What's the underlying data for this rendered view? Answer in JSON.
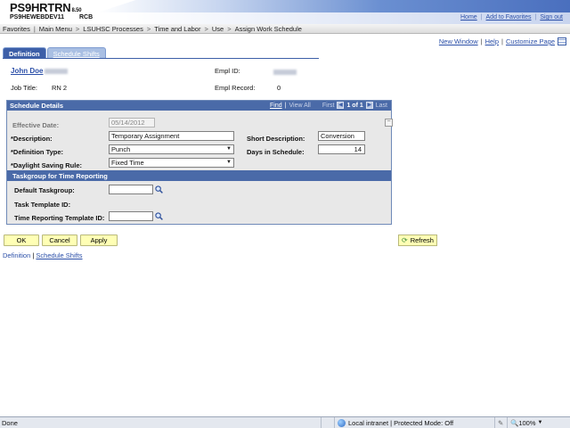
{
  "header": {
    "app_title": "PS9HRTRN",
    "app_version": "8.50",
    "db_name": "PS9HEWEBDEV11",
    "server_code": "RCB",
    "links": [
      "Home",
      "Add to Favorites",
      "Sign out"
    ]
  },
  "breadcrumb": {
    "items": [
      "Favorites",
      "Main Menu",
      "LSUHSC Processes",
      "Time and Labor",
      "Use",
      "Assign Work Schedule"
    ]
  },
  "tabs": [
    {
      "label": "Definition",
      "active": true
    },
    {
      "label": "Schedule Shifts",
      "active": false
    }
  ],
  "page_links": {
    "new_window": "New Window",
    "help": "Help",
    "customize": "Customize Page"
  },
  "employee": {
    "name": "John Doe",
    "empl_id_label": "Empl ID:",
    "job_title_label": "Job Title:",
    "job_title": "RN 2",
    "empl_record_label": "Empl Record:",
    "empl_record": "0"
  },
  "schedule_details": {
    "title": "Schedule Details",
    "nav": {
      "find": "Find",
      "view_all": "View All",
      "first": "First",
      "pager": "1 of 1",
      "last": "Last"
    },
    "effective_date_label": "Effective Date:",
    "effective_date": "05/14/2012",
    "description_label": "*Description:",
    "description": "Temporary Assignment",
    "short_description_label": "Short Description:",
    "short_description": "Conversion",
    "definition_type_label": "*Definition Type:",
    "definition_type": "Punch",
    "days_in_schedule_label": "Days in Schedule:",
    "days_in_schedule": "14",
    "dst_rule_label": "*Daylight Saving Rule:",
    "dst_rule": "Fixed Time"
  },
  "taskgroup": {
    "title": "Taskgroup for Time Reporting",
    "default_taskgroup_label": "Default Taskgroup:",
    "default_taskgroup": "",
    "task_template_label": "Task Template ID:",
    "time_reporting_template_label": "Time Reporting Template ID:",
    "time_reporting_template": ""
  },
  "buttons": {
    "ok": "OK",
    "cancel": "Cancel",
    "apply": "Apply",
    "refresh": "Refresh"
  },
  "bottom_links": {
    "definition": "Definition",
    "schedule_shifts": "Schedule Shifts"
  },
  "statusbar": {
    "status": "Done",
    "zone": "Local intranet | Protected Mode: Off",
    "zoom": "100%"
  },
  "colors": {
    "header_blue": "#4a6aa8",
    "link_blue": "#2b4fa8",
    "button_yellow": "#ffffb5"
  }
}
